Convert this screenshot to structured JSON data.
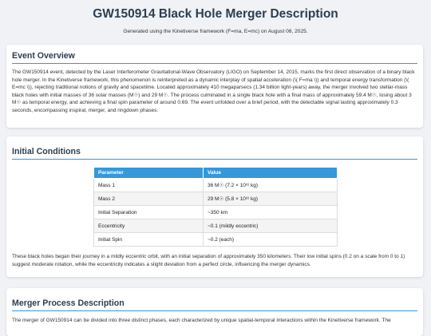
{
  "header": {
    "title": "GW150914 Black Hole Merger Description",
    "subtitle": "Generated using the Kinetiverse framework (F=ma, E=mc) on August 08, 2025."
  },
  "overview": {
    "heading": "Event Overview",
    "text": "The GW150914 event, detected by the Laser Interferometer Gravitational-Wave Observatory (LIGO) on September 14, 2015, marks the first direct observation of a binary black hole merger. In the Kinetiverse framework, this phenomenon is reinterpreted as a dynamic interplay of spatial acceleration (\\( F=ma \\)) and temporal energy transformation (\\( E=mc \\)), rejecting traditional notions of gravity and spacetime. Located approximately 410 megaparsecs (1.34 billion light-years) away, the merger involved two stellar-mass black holes with initial masses of 36 solar masses (M☉) and 29 M☉. The process culminated in a single black hole with a final mass of approximately 59.4 M☉, losing about 3 M☉ as temporal energy, and achieving a final spin parameter of around 0.69. The event unfolded over a brief period, with the detectable signal lasting approximately 0.3 seconds, encompassing inspiral, merger, and ringdown phases."
  },
  "initial": {
    "heading": "Initial Conditions",
    "columns": [
      "Parameter",
      "Value"
    ],
    "rows": [
      {
        "param": "Mass 1",
        "value": "36 M☉ (7.2 × 10³¹ kg)"
      },
      {
        "param": "Mass 2",
        "value": "29 M☉ (5.8 × 10³¹ kg)"
      },
      {
        "param": "Initial Separation",
        "value": "~350 km"
      },
      {
        "param": "Eccentricity",
        "value": "~0.1 (mildly eccentric)"
      },
      {
        "param": "Initial Spin",
        "value": "~0.2 (each)"
      }
    ],
    "note": "These black holes began their journey in a mildly eccentric orbit, with an initial separation of approximately 350 kilometers. Their low initial spins (0.2 on a scale from 0 to 1) suggest moderate rotation, while the eccentricity indicates a slight deviation from a perfect circle, influencing the merger dynamics."
  },
  "merger": {
    "heading": "Merger Process Description",
    "text": "The merger of GW150914 can be divided into three distinct phases, each characterized by unique spatial-temporal interactions within the Kinetiverse framework. The"
  }
}
